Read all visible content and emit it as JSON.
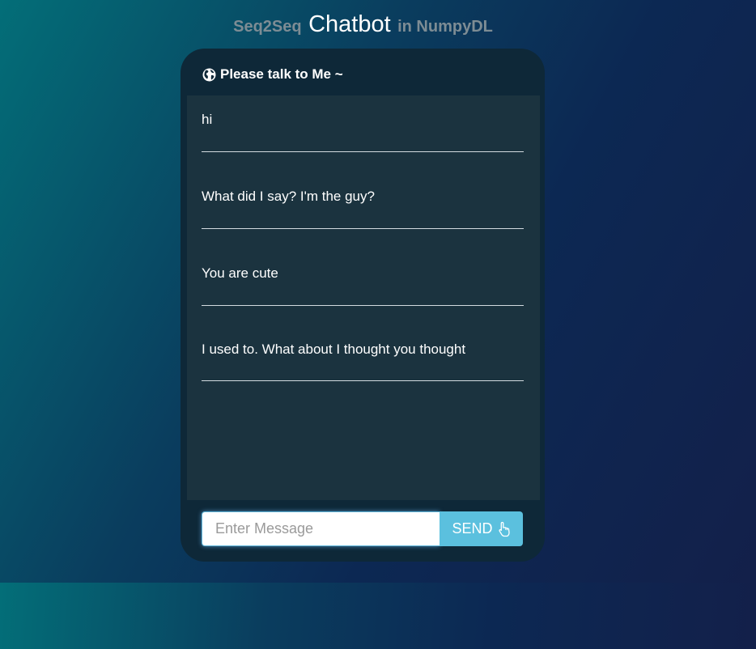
{
  "header": {
    "prefix": "Seq2Seq",
    "title": "Chatbot",
    "suffix": "in NumpyDL"
  },
  "panel": {
    "heading": "Please talk to Me ~",
    "heading_icon": "globe-icon"
  },
  "messages": [
    {
      "text": "hi"
    },
    {
      "text": "What did I say? I'm the guy?"
    },
    {
      "text": "You are cute"
    },
    {
      "text": "I used to. What about I thought you thought"
    }
  ],
  "composer": {
    "placeholder": "Enter Message",
    "value": "",
    "send_label": "SEND",
    "send_icon": "hand-pointer-icon"
  },
  "colors": {
    "accent": "#5bc0de",
    "panel": "#0e2838",
    "messages_bg": "#1b333f"
  }
}
